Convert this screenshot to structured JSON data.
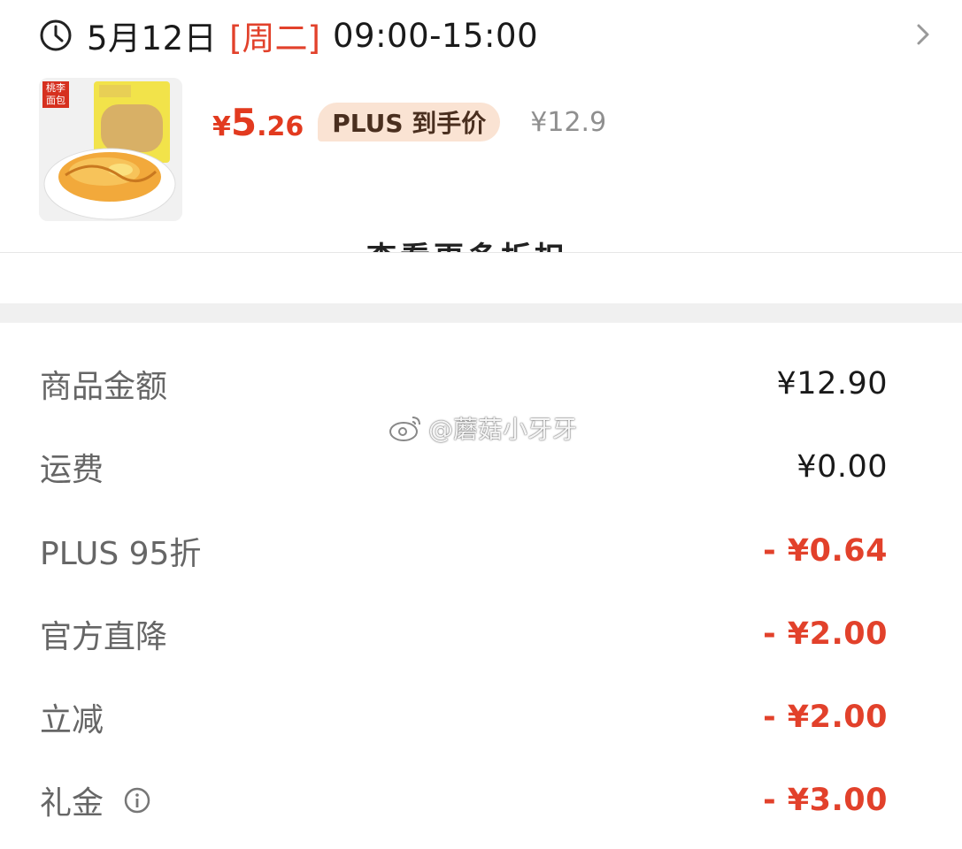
{
  "delivery": {
    "date": "5月12日",
    "weekday": "[周二]",
    "time_range": "09:00-15:00"
  },
  "product": {
    "brand_logo_text": "桃李面包",
    "price_currency": "¥",
    "price_integer": "5",
    "price_decimal": ".26",
    "badge_label": "PLUS 到手价",
    "original_price": "¥12.9"
  },
  "scrolled_hint": "查看更多折扣",
  "summary": {
    "rows": [
      {
        "label": "商品金额",
        "value": "¥12.90"
      },
      {
        "label": "运费",
        "value": "¥0.00"
      },
      {
        "label": "PLUS 95折",
        "value": "- ¥0.64"
      },
      {
        "label": "官方直降",
        "value": "- ¥2.00"
      },
      {
        "label": "立减",
        "value": "- ¥2.00"
      },
      {
        "label": "礼金",
        "value": "- ¥3.00"
      }
    ]
  },
  "watermark": {
    "text": "@蘑菇小牙牙"
  },
  "colors": {
    "accent_red": "#e2412b",
    "badge_bg": "#fae3d3",
    "muted_gray": "#8f8f8f",
    "label_gray": "#666666",
    "section_gap": "#f0f0f0"
  },
  "icons": [
    "clock-icon",
    "chevron-right-icon",
    "info-icon",
    "weibo-icon"
  ]
}
